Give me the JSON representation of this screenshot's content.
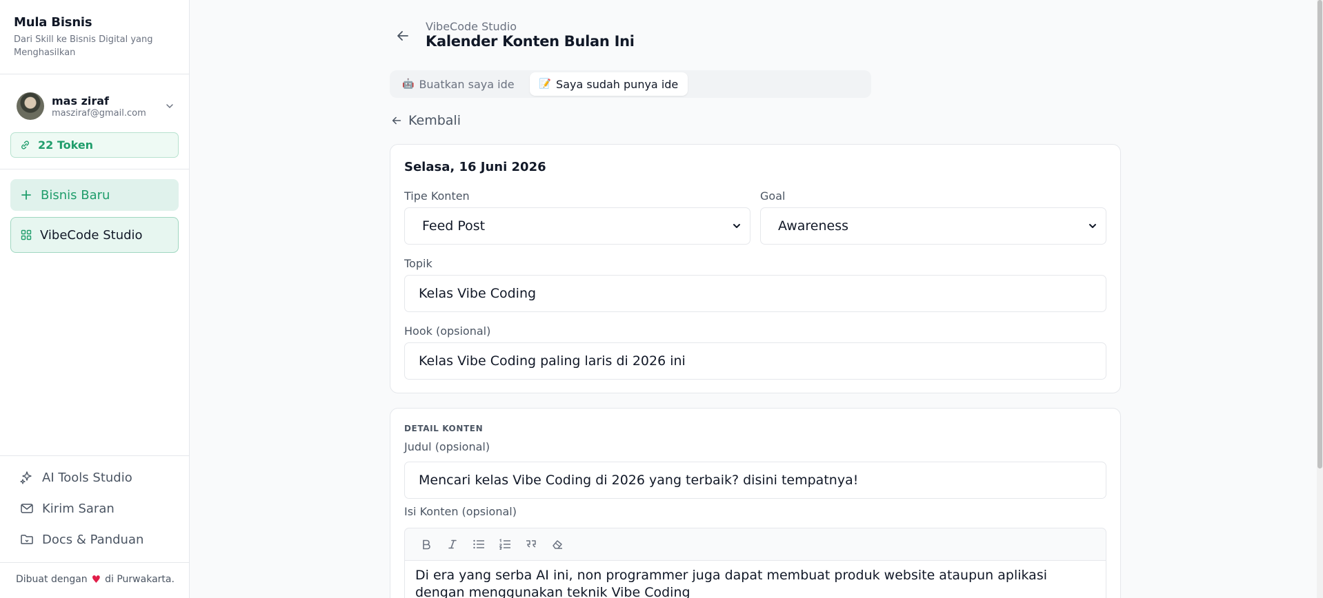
{
  "sidebar": {
    "brand_title": "Mula Bisnis",
    "brand_subtitle": "Dari Skill ke Bisnis Digital yang Menghasilkan",
    "user": {
      "name": "mas ziraf",
      "email": "masziraf@gmail.com"
    },
    "token_label": "22 Token",
    "new_business_label": "Bisnis Baru",
    "active_item_label": "VibeCode Studio",
    "bottom_items": [
      {
        "label": "AI Tools Studio",
        "icon": "sparkles-icon"
      },
      {
        "label": "Kirim Saran",
        "icon": "mail-icon"
      },
      {
        "label": "Docs & Panduan",
        "icon": "folder-icon"
      }
    ],
    "footer": {
      "prefix": "Dibuat dengan",
      "suffix": "di Purwakarta."
    }
  },
  "header": {
    "breadcrumb": "VibeCode Studio",
    "title": "Kalender Konten Bulan Ini"
  },
  "tabs": [
    {
      "label": "Buatkan saya ide",
      "active": false
    },
    {
      "label": "Saya sudah punya ide",
      "active": true
    }
  ],
  "back_label": "Kembali",
  "form": {
    "date": "Selasa, 16 Juni 2026",
    "content_type": {
      "label": "Tipe Konten",
      "value": "Feed Post"
    },
    "goal": {
      "label": "Goal",
      "value": "Awareness"
    },
    "topic": {
      "label": "Topik",
      "value": "Kelas Vibe Coding"
    },
    "hook": {
      "label": "Hook (opsional)",
      "value": "Kelas Vibe Coding paling laris di 2026 ini"
    }
  },
  "detail": {
    "section_title": "DETAIL KONTEN",
    "title_field": {
      "label": "Judul (opsional)",
      "value": "Mencari kelas Vibe Coding di 2026 yang terbaik? disini tempatnya!"
    },
    "body_field": {
      "label": "Isi Konten (opsional)",
      "value": "Di era yang serba AI ini, non programmer juga dapat membuat produk website ataupun aplikasi dengan menggunakan teknik Vibe Coding"
    }
  },
  "colors": {
    "accent": "#1f9d6b",
    "accent_bg": "#e0f2ec",
    "heart": "#e11d48"
  }
}
